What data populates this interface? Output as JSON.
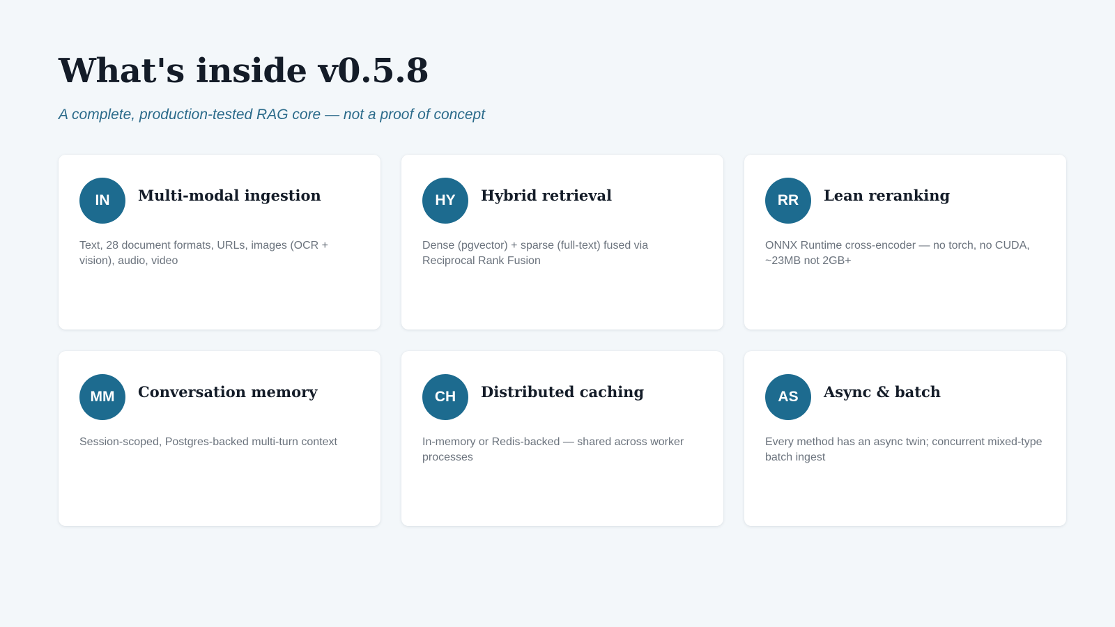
{
  "header": {
    "title": "What's inside v0.5.8",
    "subtitle": "A complete, production-tested RAG core — not a proof of concept"
  },
  "colors": {
    "background": "#f3f7fa",
    "card": "#ffffff",
    "badge": "#1d6b8f",
    "subtitle": "#2a6a8a",
    "body_text": "#6b737d"
  },
  "cards": [
    {
      "badge": "IN",
      "title": "Multi-modal ingestion",
      "description": "Text, 28 document formats, URLs, images (OCR + vision), audio, video"
    },
    {
      "badge": "HY",
      "title": "Hybrid retrieval",
      "description": "Dense (pgvector) + sparse (full-text) fused via Reciprocal Rank Fusion"
    },
    {
      "badge": "RR",
      "title": "Lean reranking",
      "description": "ONNX Runtime cross-encoder — no torch, no CUDA, ~23MB not 2GB+"
    },
    {
      "badge": "MM",
      "title": "Conversation memory",
      "description": "Session-scoped, Postgres-backed multi-turn context"
    },
    {
      "badge": "CH",
      "title": "Distributed caching",
      "description": "In-memory or Redis-backed — shared across worker processes"
    },
    {
      "badge": "AS",
      "title": "Async & batch",
      "description": "Every method has an async twin; concurrent mixed-type batch ingest"
    }
  ]
}
